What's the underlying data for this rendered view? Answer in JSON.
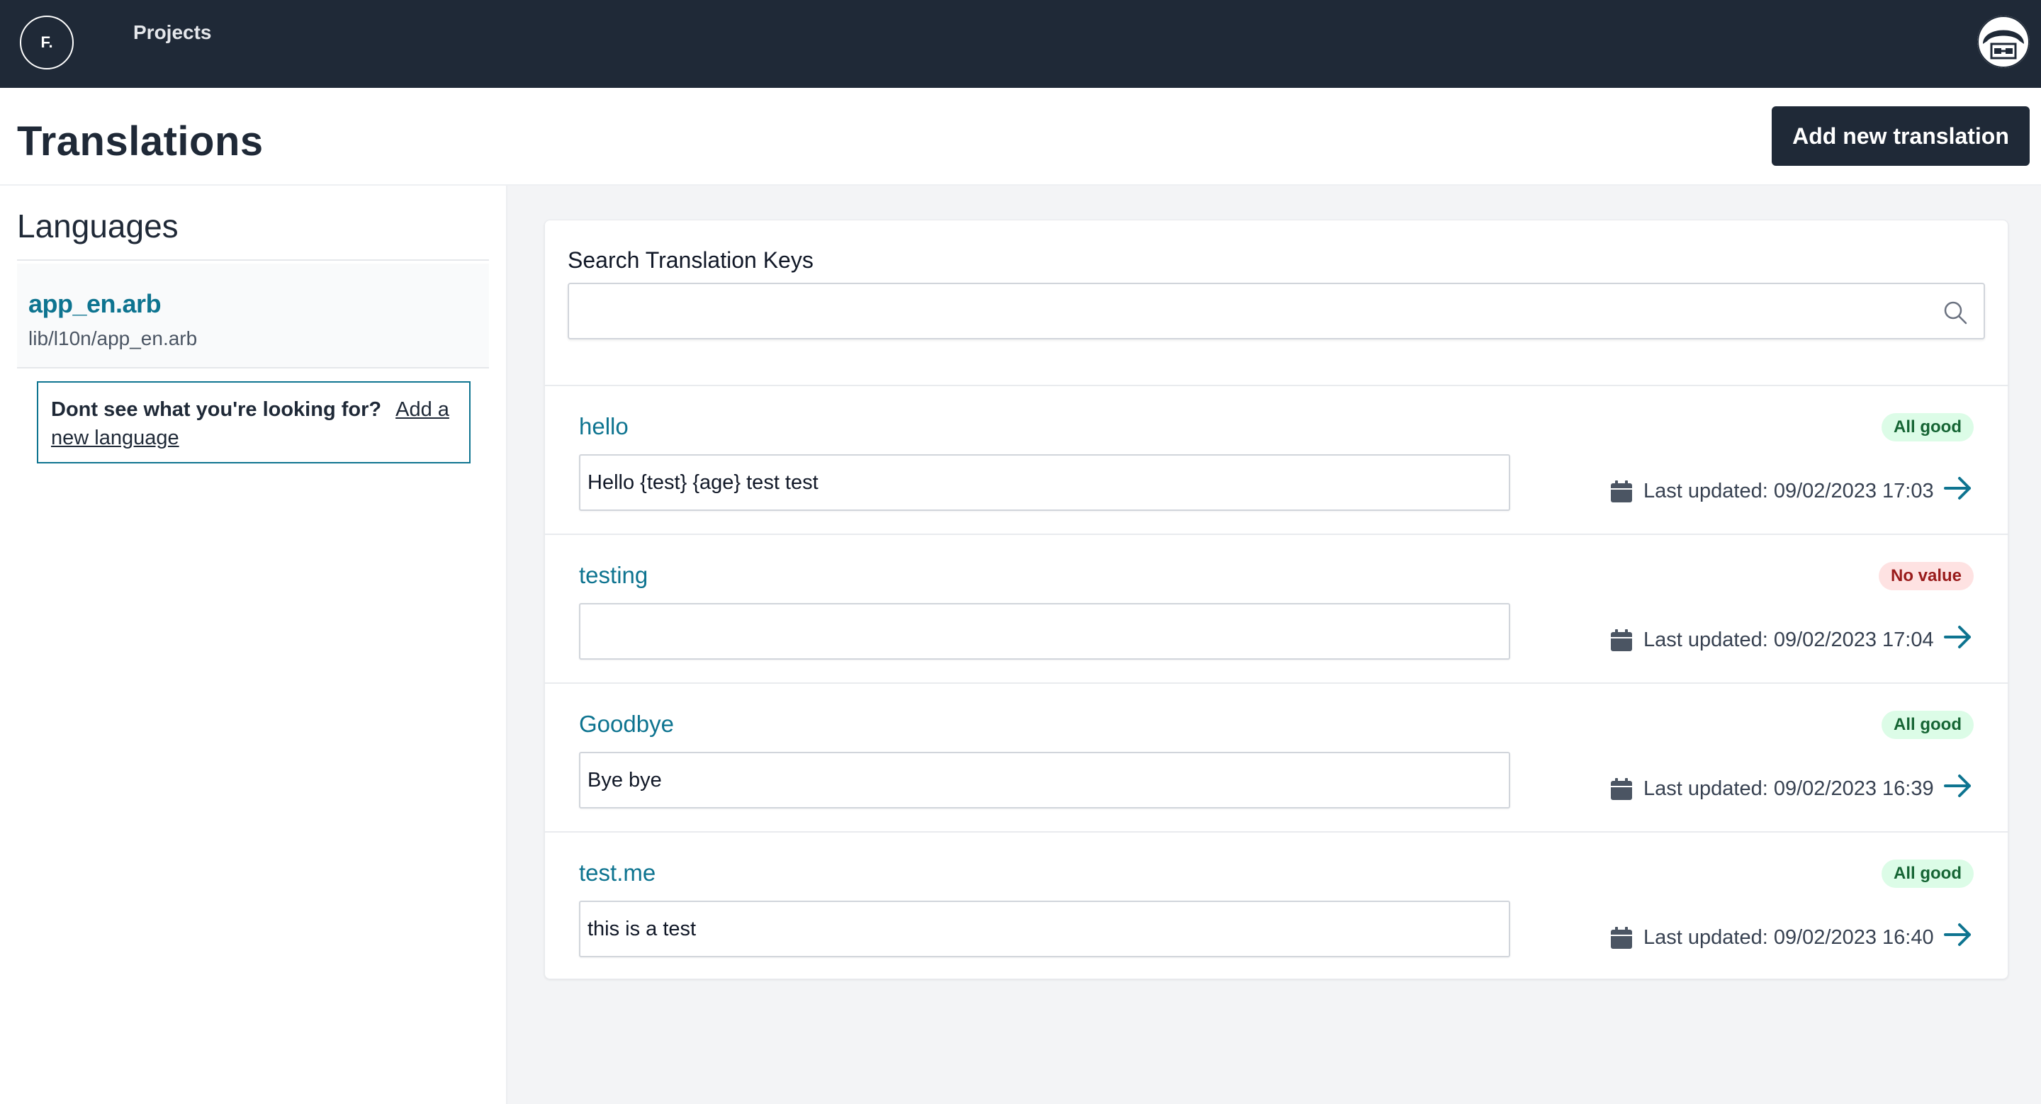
{
  "topbar": {
    "logo_text": "F.",
    "nav_projects": "Projects"
  },
  "header": {
    "title": "Translations",
    "add_button": "Add new translation"
  },
  "sidebar": {
    "heading": "Languages",
    "languages": [
      {
        "name": "app_en.arb",
        "path": "lib/l10n/app_en.arb"
      }
    ],
    "help_text": "Dont see what you're looking for?",
    "help_link": "Add a new language"
  },
  "search": {
    "label": "Search Translation Keys",
    "value": "",
    "placeholder": ""
  },
  "rows": [
    {
      "key": "hello",
      "value": "Hello {test} {age} test test",
      "status": "All good",
      "updated": "Last updated: 09/02/2023 17:03"
    },
    {
      "key": "testing",
      "value": "",
      "status": "No value",
      "updated": "Last updated: 09/02/2023 17:04"
    },
    {
      "key": "Goodbye",
      "value": "Bye bye",
      "status": "All good",
      "updated": "Last updated: 09/02/2023 16:39"
    },
    {
      "key": "test.me",
      "value": "this is a test",
      "status": "All good",
      "updated": "Last updated: 09/02/2023 16:40"
    }
  ],
  "colors": {
    "topbar": "#1f2937",
    "accent": "#0e7490",
    "good_bg": "#dcfce7",
    "good_text": "#166534",
    "bad_bg": "#fee2e2",
    "bad_text": "#991b1b"
  }
}
